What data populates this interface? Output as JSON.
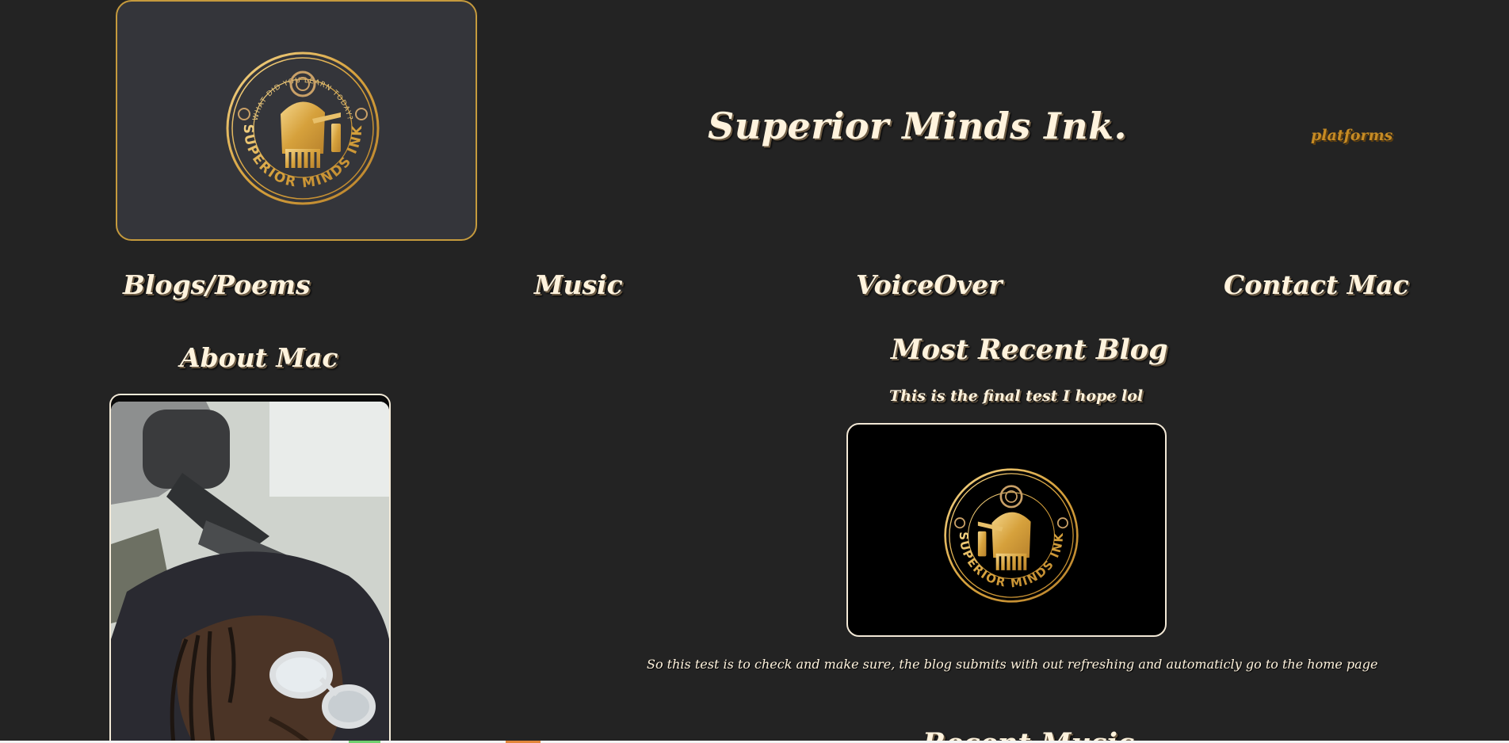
{
  "header": {
    "logo_alt": "Superior Minds Ink logo",
    "seal_ring_text": "WHAT DID YOU LEARN TODAY?",
    "seal_brand_text": "SUPERIOR MINDS INK",
    "site_title": "Superior Minds Ink.",
    "platforms_label": "platforms"
  },
  "nav": {
    "items": [
      {
        "label": "Blogs/Poems"
      },
      {
        "label": "Music"
      },
      {
        "label": "VoiceOver"
      },
      {
        "label": "Contact Mac"
      }
    ]
  },
  "about": {
    "title": "About Mac",
    "photo_alt": "Photo of Mac"
  },
  "recent_blog": {
    "section_title": "Most Recent Blog",
    "post_title": "This is the final test I hope lol",
    "image_alt": "Superior Minds Ink logo",
    "excerpt": "So this test is to check and make sure, the blog submits with out refreshing and automaticly go to the home page"
  },
  "recent_music": {
    "section_title": "Recent Music"
  },
  "colors": {
    "background": "#232323",
    "logo_card": "#34353a",
    "gold": "#c59a3d",
    "platforms": "#c68b24",
    "text_cream": "#fff3dd"
  },
  "icons": {
    "seal": "ibis-seal-icon"
  }
}
